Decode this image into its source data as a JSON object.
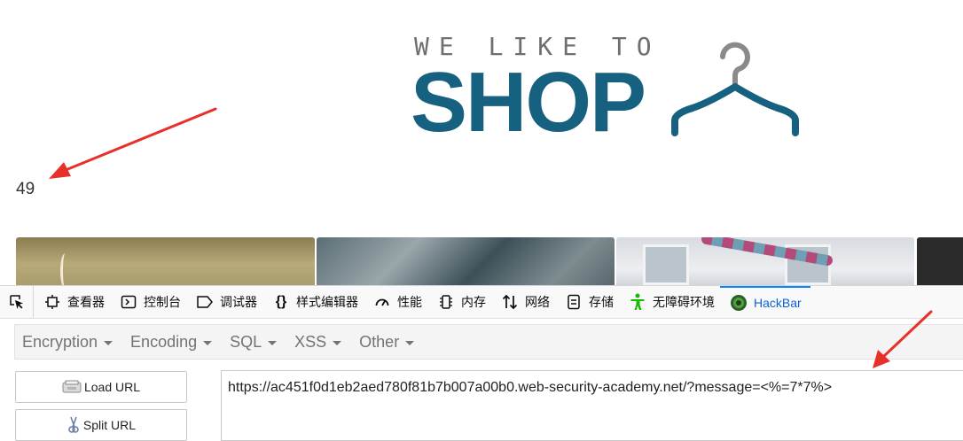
{
  "page": {
    "logo": {
      "tagline": "WE LIKE TO",
      "brand": "SHOP"
    },
    "result": "49"
  },
  "devtools": {
    "tabs": [
      {
        "label": "查看器",
        "icon": "inspector-icon"
      },
      {
        "label": "控制台",
        "icon": "console-icon"
      },
      {
        "label": "调试器",
        "icon": "debugger-icon"
      },
      {
        "label": "样式编辑器",
        "icon": "style-editor-icon"
      },
      {
        "label": "性能",
        "icon": "performance-icon"
      },
      {
        "label": "内存",
        "icon": "memory-icon"
      },
      {
        "label": "网络",
        "icon": "network-icon"
      },
      {
        "label": "存储",
        "icon": "storage-icon"
      },
      {
        "label": "无障碍环境",
        "icon": "accessibility-icon"
      },
      {
        "label": "HackBar",
        "icon": "hackbar-icon",
        "active": true
      }
    ]
  },
  "hackbar": {
    "menu": [
      "Encryption",
      "Encoding",
      "SQL",
      "XSS",
      "Other"
    ],
    "load_url": "Load URL",
    "split_url": "Split URL",
    "url": "https://ac451f0d1eb2aed780f81b7b007a00b0.web-security-academy.net/?message=<%=7*7%>"
  },
  "colors": {
    "brand": "#16617f",
    "annotation_arrow": "#e8302a",
    "active_tab": "#0a64d6"
  }
}
